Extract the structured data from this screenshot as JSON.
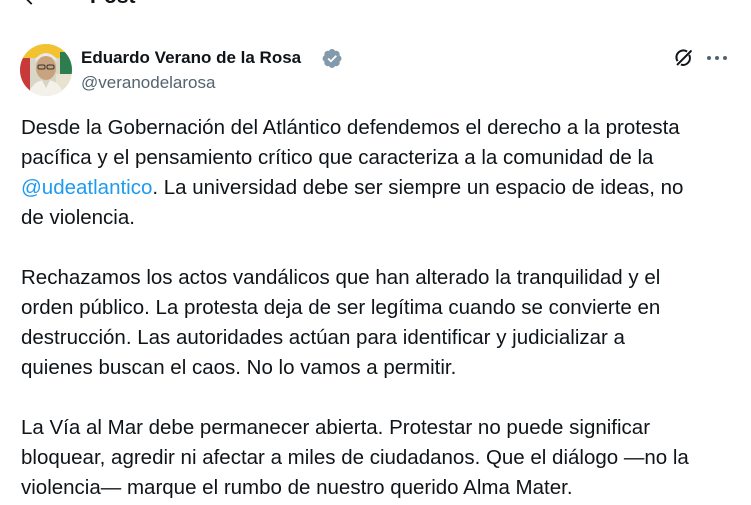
{
  "header": {
    "title": "Post"
  },
  "author": {
    "name": "Eduardo Verano de la Rosa",
    "handle": "@veranodelarosa"
  },
  "tweet": {
    "p1_l1": "Desde la Gobernación del Atlántico defendemos el derecho a la protesta",
    "p1_l2": "pacífica y el pensamiento crítico que caracteriza a la comunidad de la",
    "p1_l3_mention": "@udeatlantico",
    "p1_l3_rest": ". La universidad debe ser siempre un espacio de ideas, no",
    "p1_l4": "de violencia.",
    "p2_l1": "Rechazamos los actos vandálicos que han alterado la tranquilidad y el",
    "p2_l2": "orden público. La protesta deja de ser legítima cuando se convierte en",
    "p2_l3": "destrucción. Las autoridades actúan para identificar y judicializar a",
    "p2_l4": "quienes buscan el caos. No lo vamos a permitir.",
    "p3_l1": "La Vía al Mar debe permanecer abierta. Protestar no puede significar",
    "p3_l2": "bloquear, agredir ni afectar a miles de ciudadanos. Que el diálogo —no la",
    "p3_l3": "violencia— marque el rumbo de nuestro querido Alma Mater."
  },
  "icons": {
    "back": "arrow-left-icon",
    "verified": "verified-badge-icon",
    "grok": "grok-icon",
    "more": "more-horizontal-icon"
  },
  "colors": {
    "text": "#0f1419",
    "secondary": "#536471",
    "link": "#1d9bf0",
    "verified": "#829aab"
  }
}
